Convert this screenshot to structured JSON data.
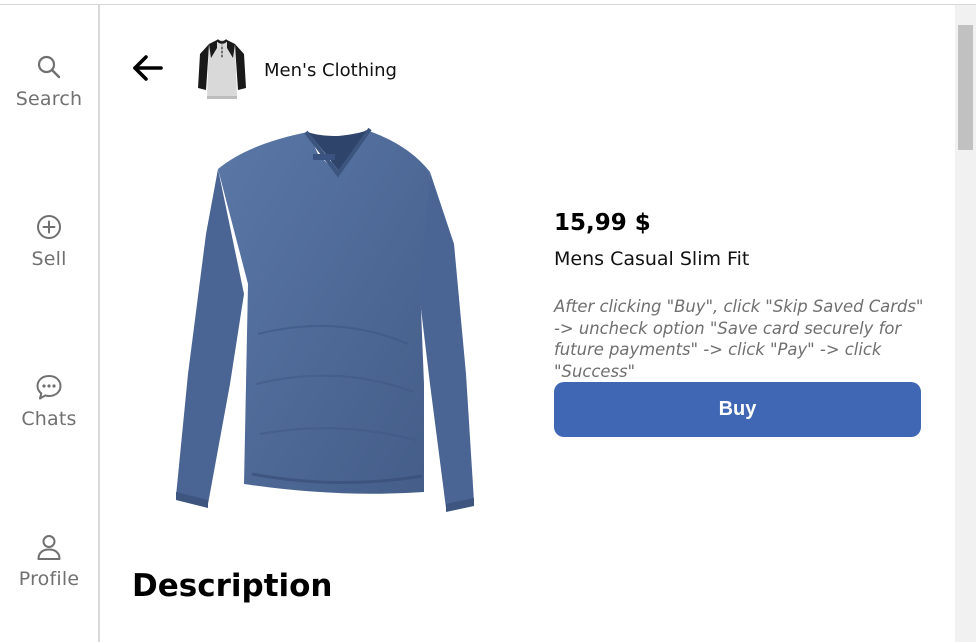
{
  "sidebar": {
    "items": [
      {
        "label": "Search",
        "icon": "search-icon"
      },
      {
        "label": "Sell",
        "icon": "plus-circle-icon"
      },
      {
        "label": "Chats",
        "icon": "chat-bubble-icon"
      },
      {
        "label": "Profile",
        "icon": "person-icon"
      }
    ]
  },
  "header": {
    "back_icon": "arrow-left-icon",
    "category": "Men's Clothing"
  },
  "product": {
    "price": "15,99 $",
    "name": "Mens Casual Slim Fit",
    "instructions": "After clicking \"Buy\", click \"Skip Saved Cards\" -> uncheck option \"Save card securely for future payments\" -> click \"Pay\" -> click \"Success\"",
    "buy_label": "Buy"
  },
  "sections": {
    "description_title": "Description"
  },
  "colors": {
    "accent": "#3f67b4",
    "shirt": "#4f6a98",
    "nav_text": "#707070"
  }
}
